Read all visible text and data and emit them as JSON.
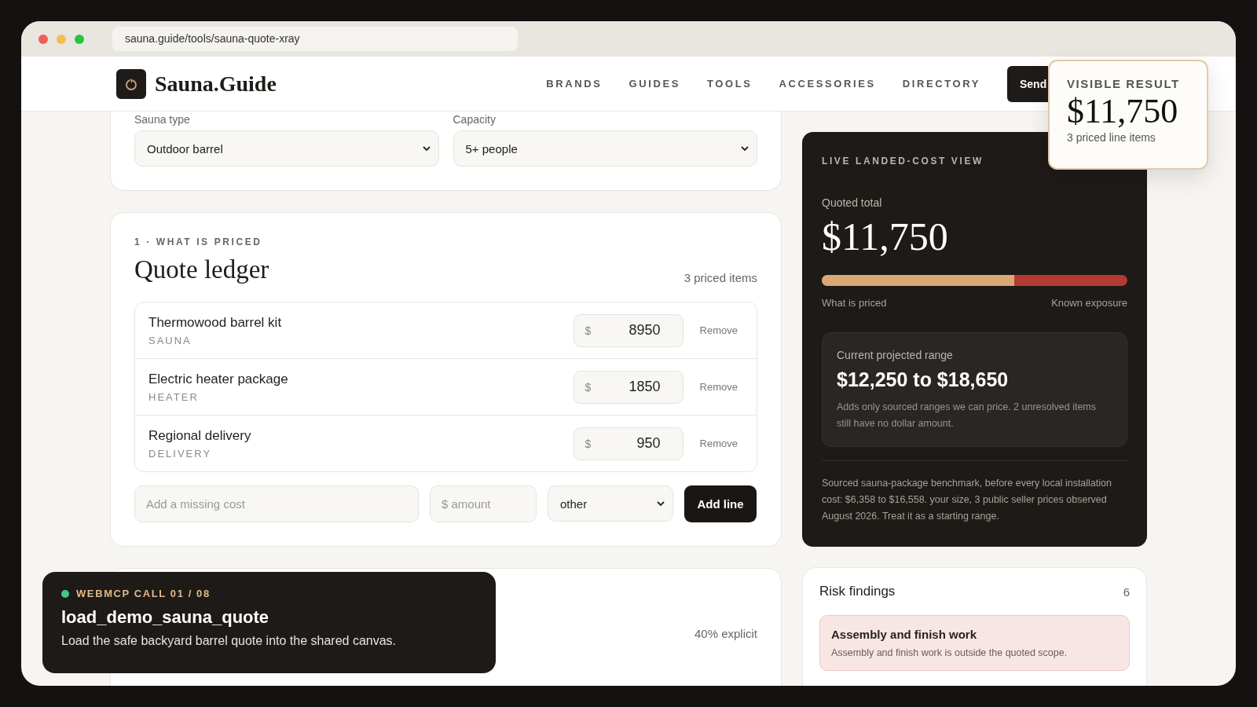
{
  "browser": {
    "url": "sauna.guide/tools/sauna-quote-xray"
  },
  "header": {
    "logo": "Sauna.Guide",
    "nav": [
      "BRANDS",
      "GUIDES",
      "TOOLS",
      "ACCESSORIES",
      "DIRECTORY"
    ],
    "button": "Send"
  },
  "filters": [
    {
      "label": "Sauna type",
      "value": "Outdoor barrel"
    },
    {
      "label": "Capacity",
      "value": "5+ people"
    }
  ],
  "ledger": {
    "eyebrow": "1 · WHAT IS PRICED",
    "title": "Quote ledger",
    "count": "3 priced items",
    "rows": [
      {
        "name": "Thermowood barrel kit",
        "category": "SAUNA",
        "currency": "$",
        "amount": "8950",
        "action": "Remove"
      },
      {
        "name": "Electric heater package",
        "category": "HEATER",
        "currency": "$",
        "amount": "1850",
        "action": "Remove"
      },
      {
        "name": "Regional delivery",
        "category": "DELIVERY",
        "currency": "$",
        "amount": "950",
        "action": "Remove"
      }
    ],
    "add": {
      "name": {
        "placeholder": "Add a missing cost"
      },
      "amount": {
        "placeholder": "$ amount"
      },
      "category": "other",
      "button": "Add line"
    }
  },
  "next_section": {
    "note": "40% explicit"
  },
  "live_view": {
    "eyebrow": "LIVE LANDED-COST VIEW",
    "total_label": "Quoted total",
    "total": "$11,750",
    "bar": {
      "level": 0.63,
      "left_label": "What is priced",
      "right_label": "Known exposure"
    },
    "range": {
      "label": "Current projected range",
      "value": "$12,250 to $18,650",
      "note": "Adds only sourced ranges we can price. 2 unresolved items still have no dollar amount."
    },
    "benchmark": "Sourced sauna-package benchmark, before every local installation cost: $6,358 to $16,558. your size, 3 public seller prices observed August 2026. Treat it as a starting range."
  },
  "risk": {
    "title": "Risk findings",
    "count": "6",
    "items": [
      {
        "title": "Assembly and finish work",
        "text": "Assembly and finish work is outside the quoted scope."
      }
    ]
  },
  "visible_result": {
    "label": "VISIBLE RESULT",
    "value": "$11,750",
    "detail": "3 priced line items"
  },
  "toast": {
    "label": "WEBMCP CALL 01 / 08",
    "title": "load_demo_sauna_quote",
    "text": "Load the safe backyard barrel quote into the shared canvas."
  }
}
